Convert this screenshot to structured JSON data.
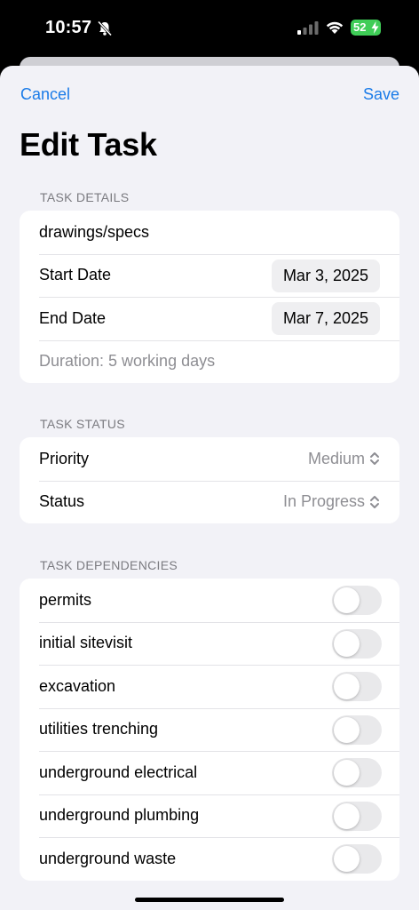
{
  "status_bar": {
    "time": "10:57",
    "battery": "52",
    "battery_color": "#3fcd57"
  },
  "nav": {
    "cancel_label": "Cancel",
    "save_label": "Save",
    "accent_color": "#1a7be8"
  },
  "title": "Edit Task",
  "task_details": {
    "header": "TASK DETAILS",
    "name": "drawings/specs",
    "start_label": "Start Date",
    "start_value": "Mar 3, 2025",
    "end_label": "End Date",
    "end_value": "Mar 7, 2025",
    "duration": "Duration: 5 working days"
  },
  "task_status": {
    "header": "TASK STATUS",
    "priority_label": "Priority",
    "priority_value": "Medium",
    "status_label": "Status",
    "status_value": "In Progress"
  },
  "task_dependencies": {
    "header": "TASK DEPENDENCIES",
    "items": [
      {
        "label": "permits",
        "on": false
      },
      {
        "label": "initial sitevisit",
        "on": false
      },
      {
        "label": "excavation",
        "on": false
      },
      {
        "label": "utilities trenching",
        "on": false
      },
      {
        "label": "underground electrical",
        "on": false
      },
      {
        "label": "underground plumbing",
        "on": false
      },
      {
        "label": "underground waste",
        "on": false
      }
    ]
  }
}
